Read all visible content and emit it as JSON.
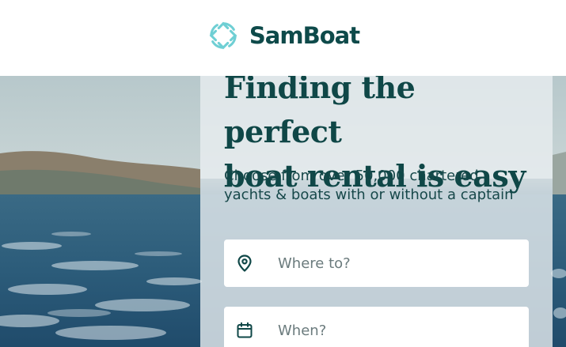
{
  "brand": {
    "name": "SamBoat",
    "color": "#0e4a4a",
    "icon_color": "#6fcfd4",
    "logo_icon": "compass-ring-icon"
  },
  "hero": {
    "title_line1": "Finding the perfect",
    "title_line2": "boat rental is easy",
    "subtitle": "Choose from over 50,000 chartered yachts & boats with or without a captain"
  },
  "search": {
    "where": {
      "placeholder": "Where to?",
      "icon": "location-pin-icon"
    },
    "when": {
      "placeholder": "When?",
      "icon": "calendar-icon"
    }
  }
}
